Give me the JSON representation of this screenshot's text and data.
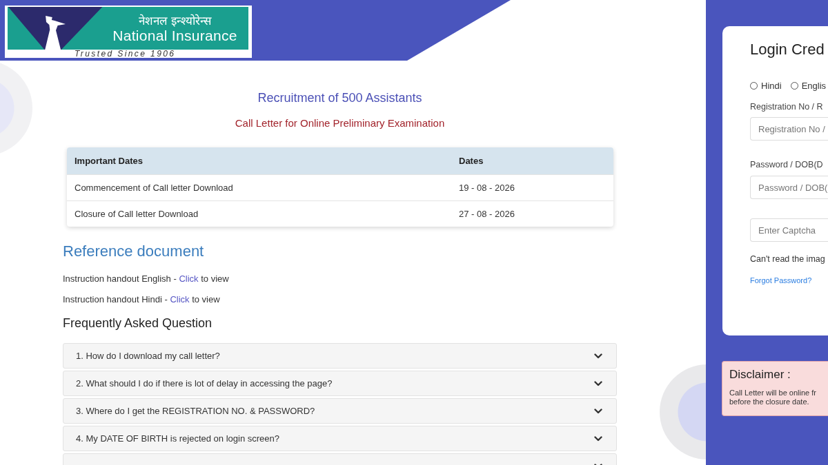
{
  "header": {
    "logo": {
      "hindi_name": "नेशनल इन्श्योरेन्स",
      "name": "National Insurance",
      "tagline": "Trusted Since 1906"
    }
  },
  "main": {
    "title": "Recruitment of 500 Assistants",
    "subtitle": "Call Letter for Online Preliminary Examination",
    "dates_table": {
      "columns": [
        "Important Dates",
        "Dates"
      ],
      "rows": [
        [
          "Commencement of Call letter Download",
          "19 - 08 - 2026"
        ],
        [
          "Closure of Call letter Download",
          "27 - 08 - 2026"
        ]
      ]
    },
    "reference": {
      "heading": "Reference document",
      "links": [
        {
          "prefix": "Instruction handout English - ",
          "link": "Click",
          "suffix": " to view"
        },
        {
          "prefix": "Instruction handout Hindi - ",
          "link": "Click",
          "suffix": " to view"
        }
      ]
    },
    "faq": {
      "heading": "Frequently Asked Question",
      "items": [
        {
          "question": "1. How do I download my call letter?",
          "expanded": false
        },
        {
          "question": "2. What should I do if there is lot of delay in accessing the page?",
          "expanded": false
        },
        {
          "question": "3. Where do I get the REGISTRATION NO. & PASSWORD?",
          "expanded": false
        },
        {
          "question": "4. My DATE OF BIRTH is rejected on login screen?",
          "expanded": false
        },
        {
          "expanded": false
        }
      ]
    }
  },
  "login": {
    "title": "Login Cred",
    "languages": [
      {
        "label": "Hindi",
        "selected": false
      },
      {
        "label": "Englis",
        "selected": false
      }
    ],
    "fields": [
      {
        "label": "Registration No / R",
        "placeholder": "Registration No /"
      },
      {
        "label": "Password / DOB(D",
        "placeholder": "Password / DOB("
      },
      {
        "placeholder": "Enter Captcha"
      }
    ],
    "captcha_hint": "Can't read the imag",
    "forgot_link": "Forgot Password?"
  },
  "disclaimer": {
    "title": "Disclaimer :",
    "lines": [
      "Call Letter will be online fr",
      "before the closure date."
    ]
  }
}
